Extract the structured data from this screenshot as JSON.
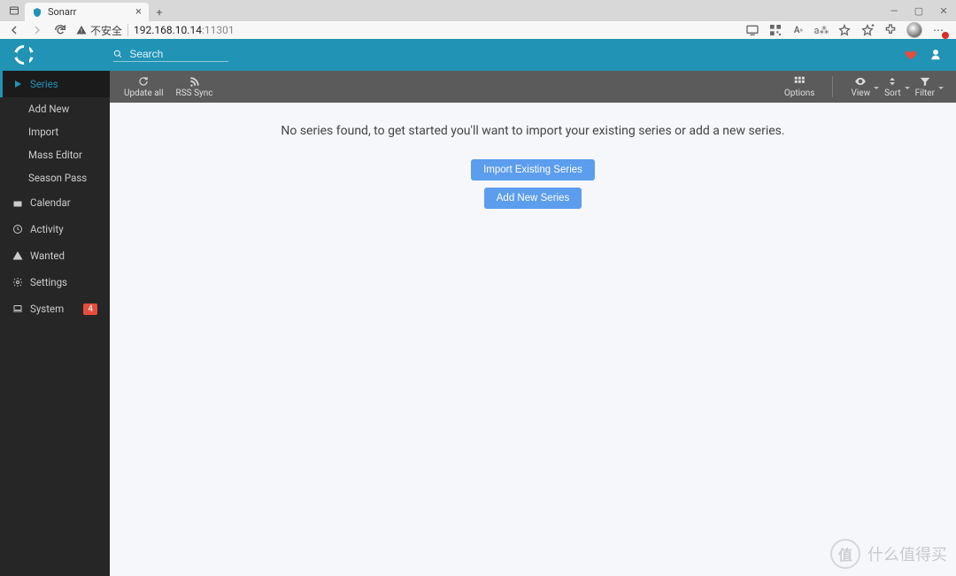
{
  "browser": {
    "tab_title": "Sonarr",
    "security_label": "不安全",
    "url_host": "192.168.10.14",
    "url_port": ":11301"
  },
  "header": {
    "search_placeholder": "Search"
  },
  "sidebar": {
    "series": "Series",
    "subs": [
      "Add New",
      "Import",
      "Mass Editor",
      "Season Pass"
    ],
    "calendar": "Calendar",
    "activity": "Activity",
    "wanted": "Wanted",
    "settings": "Settings",
    "system": "System",
    "system_badge": "4"
  },
  "page_toolbar": {
    "update_all": "Update all",
    "rss_sync": "RSS Sync",
    "options": "Options",
    "view": "View",
    "sort": "Sort",
    "filter": "Filter"
  },
  "content": {
    "empty_msg": "No series found, to get started you'll want to import your existing series or add a new series.",
    "import_btn": "Import Existing Series",
    "add_btn": "Add New Series"
  },
  "watermark": {
    "char": "值",
    "text": "什么值得买"
  }
}
